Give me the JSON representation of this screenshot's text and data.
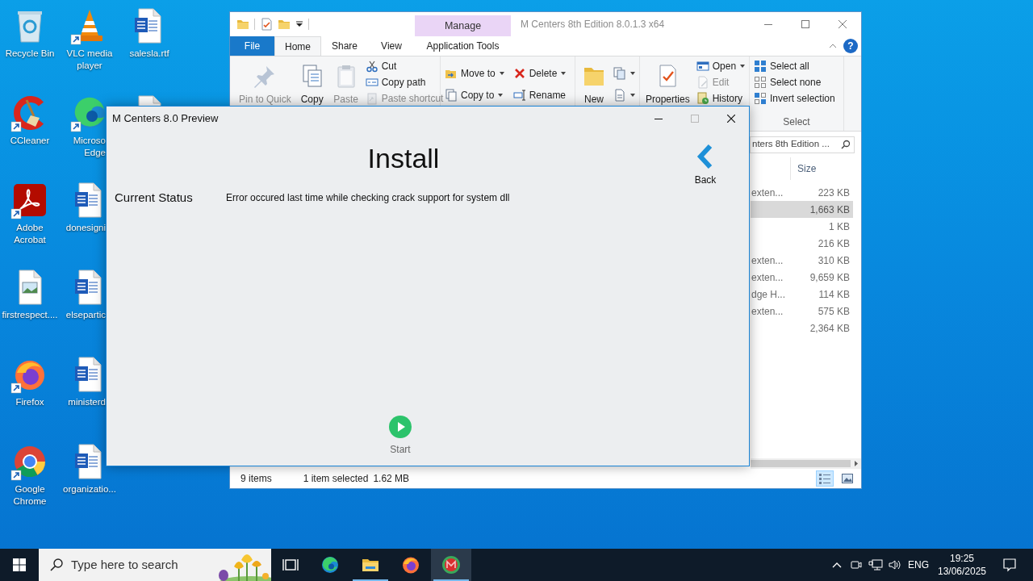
{
  "desktop": {
    "columns": [
      [
        {
          "label": "Recycle Bin",
          "kind": "recycle-bin",
          "shortcut": false,
          "cut": false
        },
        {
          "label": "CCleaner",
          "kind": "ccleaner",
          "shortcut": true,
          "cut": false
        },
        {
          "label": "Adobe Acrobat",
          "kind": "acrobat",
          "shortcut": true,
          "cut": false
        },
        {
          "label": "firstrespect....",
          "kind": "image-file",
          "shortcut": false,
          "cut": false
        },
        {
          "label": "Firefox",
          "kind": "firefox",
          "shortcut": true,
          "cut": false
        },
        {
          "label": "Google Chrome",
          "kind": "chrome",
          "shortcut": true,
          "cut": false
        }
      ],
      [
        {
          "label": "VLC media player",
          "kind": "vlc",
          "shortcut": true,
          "cut": false
        },
        {
          "label": "Microso Edge",
          "kind": "edge",
          "shortcut": true,
          "cut": true
        },
        {
          "label": "donesigni",
          "kind": "word",
          "shortcut": false,
          "cut": true
        },
        {
          "label": "elsepartic",
          "kind": "word",
          "shortcut": false,
          "cut": true
        },
        {
          "label": "ministerd",
          "kind": "word",
          "shortcut": false,
          "cut": true
        },
        {
          "label": "organizatio...",
          "kind": "word",
          "shortcut": false,
          "cut": false
        }
      ],
      [
        {
          "label": "salesla.rtf",
          "kind": "word",
          "shortcut": false,
          "cut": false
        },
        {
          "kind": "blank-doc",
          "cut": true
        }
      ]
    ]
  },
  "explorer": {
    "title": "M Centers 8th Edition 8.0.1.3 x64",
    "context_label": "Manage",
    "help": "?",
    "tabs": [
      {
        "label": "File",
        "kind": "file",
        "selected": false
      },
      {
        "label": "Home",
        "kind": "tab",
        "selected": true
      },
      {
        "label": "Share",
        "kind": "tab",
        "selected": false
      },
      {
        "label": "View",
        "kind": "tab",
        "selected": false
      },
      {
        "label": "Application Tools",
        "kind": "context",
        "selected": false
      }
    ],
    "ribbon": [
      {
        "items": [
          {
            "kind": "large",
            "label": "Pin to Quick",
            "disabled": true,
            "dropdown": false
          },
          {
            "kind": "large",
            "label": "Copy",
            "disabled": false,
            "dropdown": false
          },
          {
            "kind": "large",
            "label": "Paste",
            "disabled": true,
            "dropdown": false
          },
          {
            "kind": "stack",
            "items": [
              {
                "label": "Cut",
                "disabled": false,
                "dropdown": false
              },
              {
                "label": "Copy path",
                "disabled": false,
                "dropdown": false
              },
              {
                "label": "Paste shortcut",
                "disabled": true,
                "dropdown": false
              }
            ]
          }
        ]
      },
      {
        "items": [
          {
            "kind": "stack",
            "items": [
              {
                "label": "Move to",
                "disabled": false,
                "dropdown": true
              },
              {
                "label": "Copy to",
                "disabled": false,
                "dropdown": true
              }
            ]
          },
          {
            "kind": "stack",
            "items": [
              {
                "label": "Delete",
                "disabled": false,
                "dropdown": true
              },
              {
                "label": "Rename",
                "disabled": false,
                "dropdown": false
              }
            ]
          }
        ]
      },
      {
        "items": [
          {
            "kind": "large",
            "label": "New",
            "disabled": false,
            "dropdown": false
          },
          {
            "kind": "stack",
            "items": [
              {
                "disabled": false,
                "dropdown": true
              },
              {
                "disabled": false,
                "dropdown": true
              }
            ]
          }
        ]
      },
      {
        "items": [
          {
            "kind": "large",
            "label": "Properties",
            "disabled": false,
            "dropdown": false
          },
          {
            "kind": "stack",
            "items": [
              {
                "label": "Open",
                "disabled": false,
                "dropdown": true
              },
              {
                "label": "Edit",
                "disabled": true,
                "dropdown": false
              },
              {
                "label": "History",
                "disabled": false,
                "dropdown": false
              }
            ]
          }
        ]
      },
      {
        "label": "Select",
        "items": [
          {
            "kind": "stack",
            "items": [
              {
                "label": "Select all",
                "disabled": false,
                "dropdown": false
              },
              {
                "label": "Select none",
                "disabled": false,
                "dropdown": false
              },
              {
                "label": "Invert selection",
                "disabled": false,
                "dropdown": false
              }
            ]
          }
        ]
      }
    ],
    "search": {
      "value": "nters 8th Edition ..."
    },
    "columns": [
      "Size"
    ],
    "rows": [
      {
        "type": "exten...",
        "size": "223 KB",
        "selected": false
      },
      {
        "size": "1,663 KB",
        "selected": true
      },
      {
        "size": "1 KB",
        "selected": false
      },
      {
        "size": "216 KB",
        "selected": false
      },
      {
        "type": "exten...",
        "size": "310 KB",
        "selected": false
      },
      {
        "type": "exten...",
        "size": "9,659 KB",
        "selected": false
      },
      {
        "type": "dge H...",
        "size": "114 KB",
        "selected": false
      },
      {
        "type": "exten...",
        "size": "575 KB",
        "selected": false
      },
      {
        "size": "2,364 KB",
        "selected": false
      }
    ],
    "status": {
      "count": "9 items",
      "selection": "1 item selected",
      "selection_size": "1.62 MB"
    },
    "views": [
      {
        "kind": "details",
        "selected": true
      },
      {
        "kind": "large-icons",
        "selected": false
      }
    ]
  },
  "installer": {
    "title": "M Centers 8.0 Preview",
    "heading": "Install",
    "back_label": "Back",
    "status_label": "Current Status",
    "status_text": "Error occured last time while checking crack support for system dll",
    "start_label": "Start",
    "controls": [
      {
        "kind": "minimize",
        "disabled": false
      },
      {
        "kind": "maximize",
        "disabled": true
      },
      {
        "kind": "close",
        "disabled": false
      }
    ]
  },
  "taskbar": {
    "search_placeholder": "Type here to search",
    "apps": [
      {
        "kind": "task-view",
        "active": false,
        "running": false
      },
      {
        "kind": "edge",
        "active": false,
        "running": false
      },
      {
        "kind": "explorer",
        "active": false,
        "running": true
      },
      {
        "kind": "firefox",
        "active": false,
        "running": false
      },
      {
        "kind": "mcenters",
        "active": true,
        "running": true
      }
    ],
    "tray": {
      "language": "ENG",
      "time": "19:25",
      "date": "13/06/2025"
    }
  }
}
